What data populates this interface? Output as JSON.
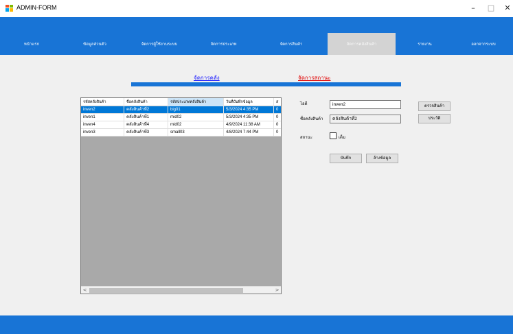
{
  "window": {
    "title": "ADMIN-FORM",
    "minimize": "–",
    "maximize": "□",
    "close": "✕"
  },
  "nav": {
    "items": [
      {
        "label": "หน้าแรก"
      },
      {
        "label": "ข้อมูลส่วนตัว"
      },
      {
        "label": "จัดการผู้ใช้งานระบบ"
      },
      {
        "label": "จัดการประเภท"
      },
      {
        "label": "จัดการสินค้า"
      },
      {
        "label": "จัดการคลังสินค้า"
      },
      {
        "label": "รายงาน"
      },
      {
        "label": "ออกจากระบบ"
      }
    ],
    "active_index": 5
  },
  "tabs": {
    "warehouse_label": "จัดการคลัง",
    "status_label": "จัดการสถานะ",
    "warehouse_color": "#1a1aff",
    "status_color": "#e00000"
  },
  "grid": {
    "columns": [
      "รหัสคลังสินค้า",
      "ชื่อคลังสินค้า",
      "รหัสประเภทคลังสินค้า",
      "วันที่บันทึกข้อมูล",
      "ส"
    ],
    "rows": [
      [
        "inven2",
        "คลังสินค้าที่2",
        "big01",
        "5/3/2024 4:35 PM",
        "0"
      ],
      [
        "inven1",
        "คลังสินค้าที่1",
        "mid02",
        "5/3/2024 4:35 PM",
        "0"
      ],
      [
        "inven4",
        "คลังสินค้าที่4",
        "mid02",
        "4/9/2024 11:38 AM",
        "0"
      ],
      [
        "inven3",
        "คลังสินค้าที่3",
        "small03",
        "4/8/2024 7:44 PM",
        "0"
      ]
    ],
    "selected_row": 0,
    "scroll_left": "<",
    "scroll_right": ">"
  },
  "form": {
    "id_label": "ไอดี",
    "id_value": "inven2",
    "name_label": "ชื่อคลังสินค้า",
    "name_value": "คลังสินค้าที่2",
    "status_label": "สถานะ",
    "full_label": "เต็ม",
    "save_button": "บันทึก",
    "clear_button": "ล้างข้อมูล",
    "check_product_button": "ตรวจสินค้า",
    "history_button": "ประวัติ"
  },
  "colors": {
    "accent": "#1874d6",
    "selection": "#0078d7"
  }
}
